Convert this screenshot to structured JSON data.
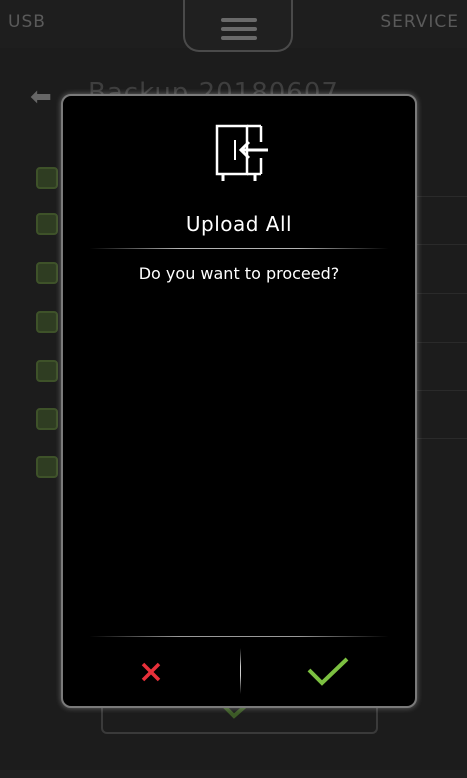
{
  "topbar": {
    "left_label": "USB",
    "right_label": "SERVICE",
    "menu_icon": "hamburger-icon"
  },
  "background": {
    "back_icon": "arrow-left-icon",
    "title": "Backup 20180607",
    "checkbox_count": 7,
    "checkbox_color": "#3e5229"
  },
  "dialog": {
    "icon": "oven-door-upload-icon",
    "title": "Upload All",
    "message": "Do you want to proceed?",
    "cancel_icon": "cross-icon",
    "confirm_icon": "checkmark-icon",
    "cancel_color": "#e8303a",
    "confirm_color": "#7cc041"
  }
}
